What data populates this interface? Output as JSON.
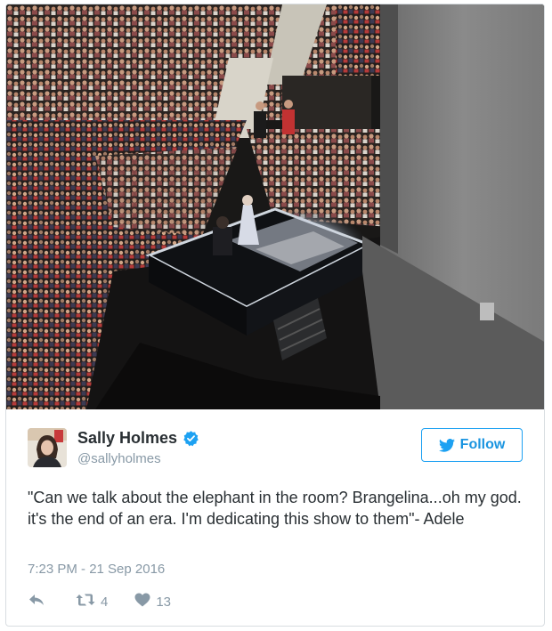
{
  "tweet": {
    "author": {
      "display_name": "Sally Holmes",
      "handle": "@sallyholmes",
      "verified": true
    },
    "follow_label": "Follow",
    "text": "\"Can we talk about the elephant in the room? Brangelina...oh my god. it's the end of an era. I'm dedicating this show to them\"- Adele",
    "timestamp": "7:23 PM - 21 Sep 2016",
    "actions": {
      "retweet_count": "4",
      "like_count": "13"
    }
  },
  "colors": {
    "twitter_blue": "#1da1f2",
    "follow_text": "#1b95e0",
    "name_text": "#292f33",
    "muted_text": "#8899a6"
  },
  "icons": {
    "verified": "verified-badge-icon",
    "follow": "twitter-bird-icon",
    "reply": "reply-arrow-icon",
    "retweet": "retweet-icon",
    "like": "heart-icon"
  }
}
